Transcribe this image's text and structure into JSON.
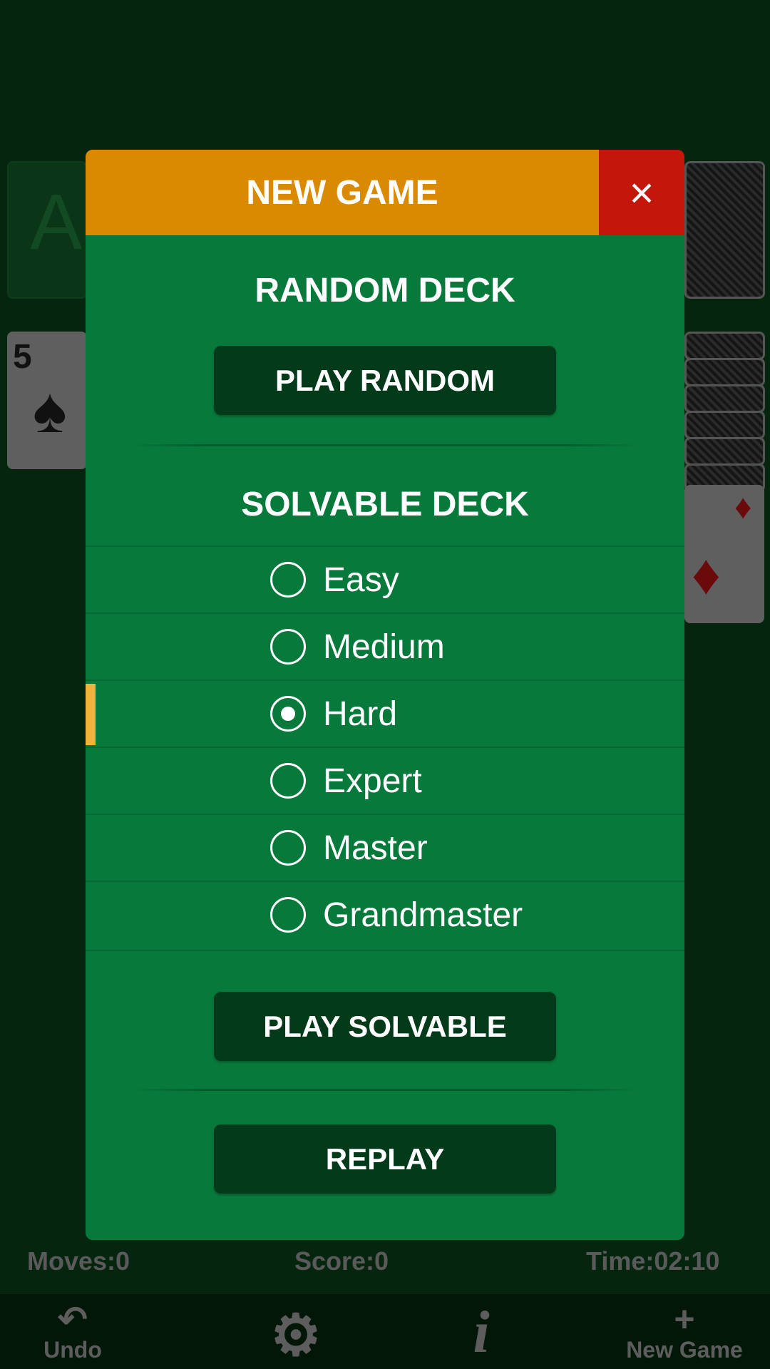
{
  "background": {
    "foundation_card": "A",
    "tableau_card": {
      "rank": "5",
      "suit": "♠"
    },
    "red_card": {
      "suit": "♦"
    }
  },
  "dialog": {
    "title": "NEW GAME",
    "close_icon": "×",
    "random_heading": "RANDOM DECK",
    "play_random": "PLAY RANDOM",
    "solvable_heading": "SOLVABLE DECK",
    "difficulties": [
      {
        "label": "Easy",
        "selected": false
      },
      {
        "label": "Medium",
        "selected": false
      },
      {
        "label": "Hard",
        "selected": true
      },
      {
        "label": "Expert",
        "selected": false
      },
      {
        "label": "Master",
        "selected": false
      },
      {
        "label": "Grandmaster",
        "selected": false
      }
    ],
    "play_solvable": "PLAY SOLVABLE",
    "replay": "REPLAY",
    "colors": {
      "header": "#da8a00",
      "close": "#c4170c",
      "body": "#077a3b",
      "button": "#033a19",
      "indicator": "#f2b33a"
    }
  },
  "stats": {
    "moves": "Moves:0",
    "score": "Score:0",
    "time": "Time:02:10"
  },
  "toolbar": {
    "undo_icon": "↶",
    "undo": "Undo",
    "settings_icon": "⚙",
    "info_icon": "i",
    "new_icon": "+",
    "new_game": "New Game"
  }
}
